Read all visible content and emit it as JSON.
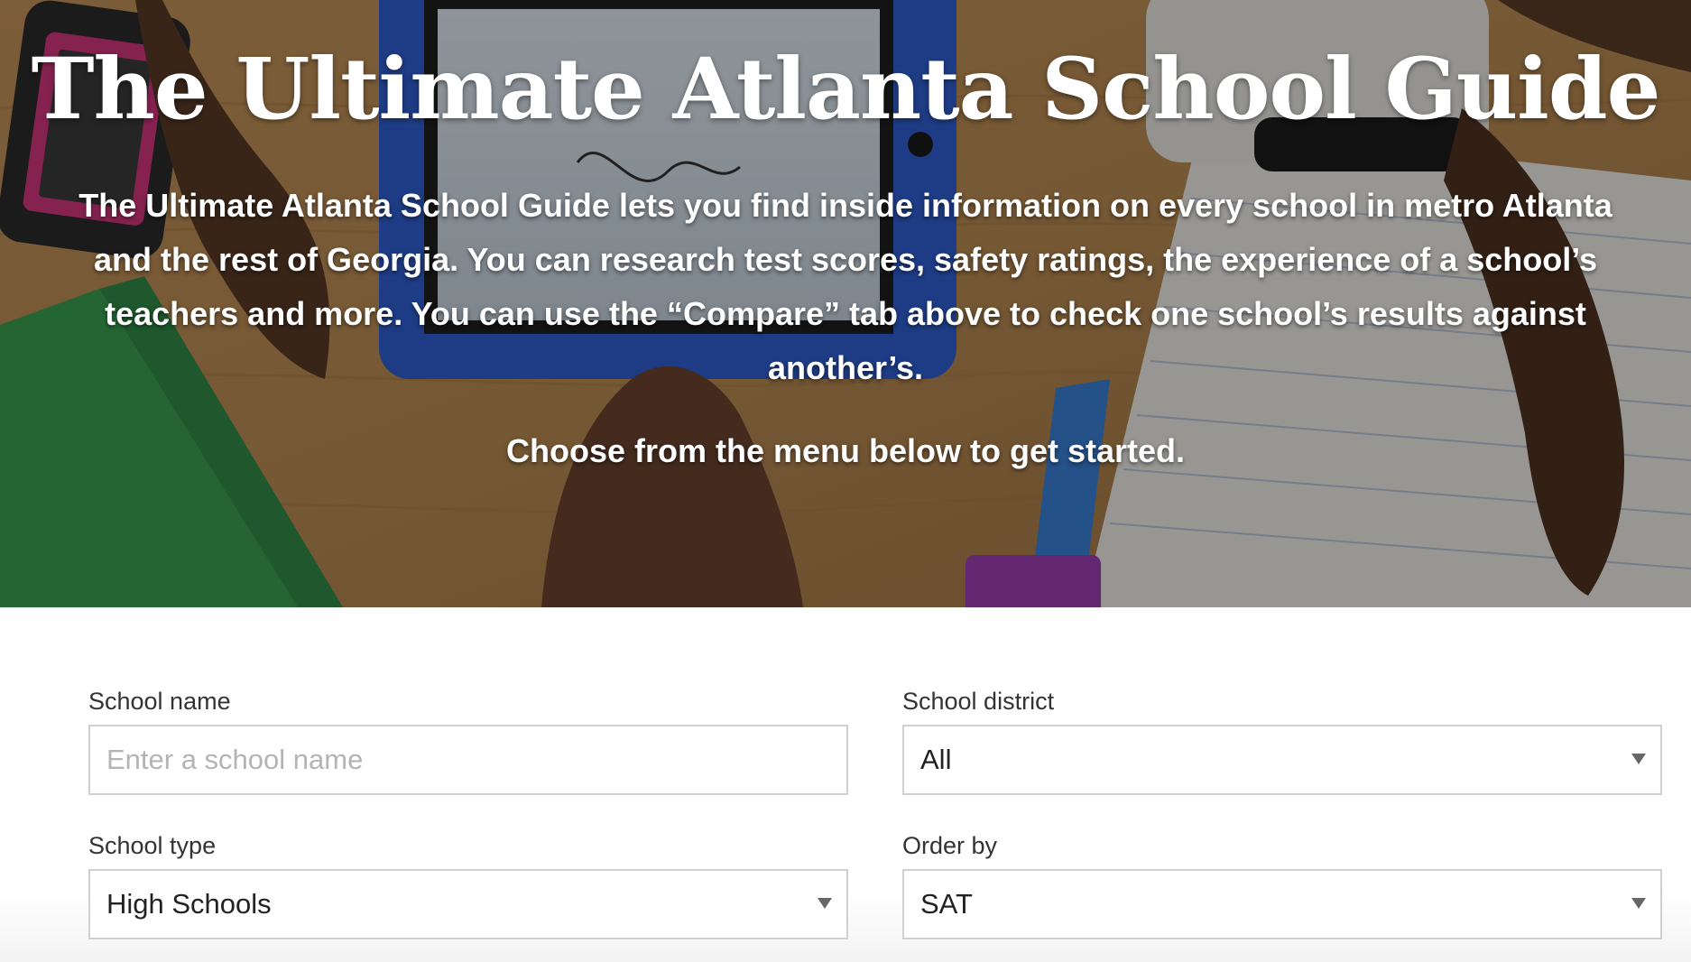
{
  "hero": {
    "title": "The Ultimate Atlanta School Guide",
    "description": "The Ultimate Atlanta School Guide lets you find inside information on every school in metro Atlanta and the rest of Georgia. You can research test scores, safety ratings, the experience of a school’s teachers and more. You can use the “Compare” tab above to check one school’s results against another’s.",
    "cta": "Choose from the menu below to get started."
  },
  "filters": {
    "school_name": {
      "label": "School name",
      "placeholder": "Enter a school name",
      "value": ""
    },
    "school_district": {
      "label": "School district",
      "value": "All"
    },
    "school_type": {
      "label": "School type",
      "value": "High Schools"
    },
    "order_by": {
      "label": "Order by",
      "value": "SAT"
    }
  },
  "icons": {
    "dropdown": "caret-down-icon"
  }
}
